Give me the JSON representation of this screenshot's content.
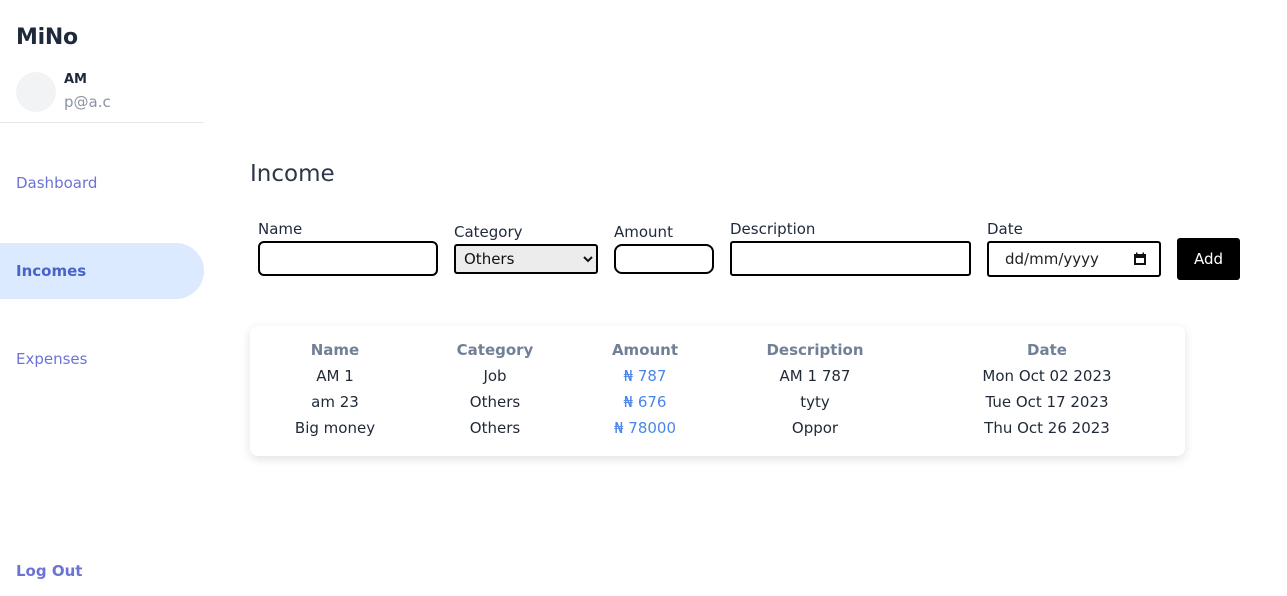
{
  "sidebar": {
    "brand": "MiNo",
    "user": {
      "name": "AM",
      "email": "p@a.c"
    },
    "nav": [
      {
        "label": "Dashboard",
        "active": false
      },
      {
        "label": "Incomes",
        "active": true
      },
      {
        "label": "Expenses",
        "active": false
      }
    ],
    "logout_label": "Log Out"
  },
  "main": {
    "title": "Income",
    "form": {
      "name_label": "Name",
      "name_value": "",
      "category_label": "Category",
      "category_selected": "Others",
      "amount_label": "Amount",
      "amount_value": "",
      "description_label": "Description",
      "description_value": "",
      "date_label": "Date",
      "date_placeholder": "dd/mm/yyyy",
      "add_label": "Add"
    },
    "table": {
      "headers": [
        "Name",
        "Category",
        "Amount",
        "Description",
        "Date"
      ],
      "rows": [
        [
          "AM 1",
          "Job",
          "₦ 787",
          "AM 1 787",
          "Mon Oct 02 2023"
        ],
        [
          "am 23",
          "Others",
          "₦ 676",
          "tyty",
          "Tue Oct 17 2023"
        ],
        [
          "Big money",
          "Others",
          "₦ 78000",
          "Oppor",
          "Thu Oct 26 2023"
        ]
      ]
    }
  },
  "colors": {
    "nav_link": "#6b74d6",
    "nav_active_bg": "#dbeafe",
    "amount_link": "#4a86e8",
    "header_text": "#718096",
    "button_bg": "#000000"
  },
  "icons": {
    "date_picker": "calendar-icon"
  }
}
